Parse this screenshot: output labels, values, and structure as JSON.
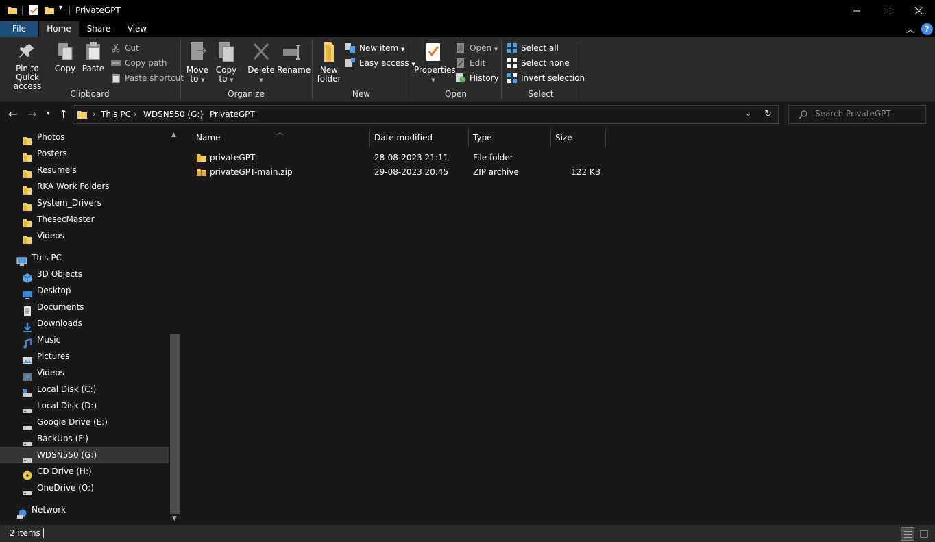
{
  "window": {
    "title": "PrivateGPT",
    "controls": [
      "minimize-icon",
      "maximize-icon",
      "close-icon"
    ]
  },
  "ribbon_tabs": [
    "File",
    "Home",
    "Share",
    "View"
  ],
  "ribbon": {
    "clipboard": {
      "group_label": "Clipboard",
      "pin_line1": "Pin to Quick",
      "pin_line2": "access",
      "copy": "Copy",
      "paste": "Paste",
      "cut": "Cut",
      "copy_path": "Copy path",
      "paste_shortcut": "Paste shortcut"
    },
    "organize": {
      "group_label": "Organize",
      "move_line1": "Move",
      "move_line2": "to",
      "copy_line1": "Copy",
      "copy_line2": "to",
      "delete": "Delete",
      "rename": "Rename"
    },
    "new": {
      "group_label": "New",
      "new_folder_line1": "New",
      "new_folder_line2": "folder",
      "new_item": "New item",
      "easy_access": "Easy access"
    },
    "open": {
      "group_label": "Open",
      "properties": "Properties",
      "open": "Open",
      "edit": "Edit",
      "history": "History"
    },
    "select": {
      "group_label": "Select",
      "select_all": "Select all",
      "select_none": "Select none",
      "invert_selection": "Invert selection"
    }
  },
  "address": {
    "crumbs": [
      "This PC",
      "WDSN550 (G:)",
      "PrivateGPT"
    ],
    "search_placeholder": "Search PrivateGPT"
  },
  "nav_pane": {
    "quick_access_items": [
      "Photos",
      "Posters",
      "Resume's",
      "RKA Work Folders",
      "System_Drivers",
      "ThesecMaster",
      "Videos"
    ],
    "this_pc": "This PC",
    "this_pc_items": [
      "3D Objects",
      "Desktop",
      "Documents",
      "Downloads",
      "Music",
      "Pictures",
      "Videos",
      "Local Disk (C:)",
      "Local Disk (D:)",
      "Google Drive (E:)",
      "BackUps (F:)",
      "WDSN550 (G:)",
      "CD Drive (H:)",
      "OneDrive (O:)"
    ],
    "network": "Network",
    "selected": "WDSN550 (G:)"
  },
  "file_list": {
    "columns": [
      "Name",
      "Date modified",
      "Type",
      "Size"
    ],
    "rows": [
      {
        "name": "privateGPT",
        "date": "28-08-2023 21:11",
        "type": "File folder",
        "size": "",
        "icon": "folder-icon"
      },
      {
        "name": "privateGPT-main.zip",
        "date": "29-08-2023 20:45",
        "type": "ZIP archive",
        "size": "122 KB",
        "icon": "zip-folder-icon"
      }
    ]
  },
  "status": {
    "item_count": "2 items"
  },
  "colors": {
    "folder": "#f5d06a",
    "accent_blue": "#1f4e79",
    "help_blue": "#3d8ee6"
  }
}
